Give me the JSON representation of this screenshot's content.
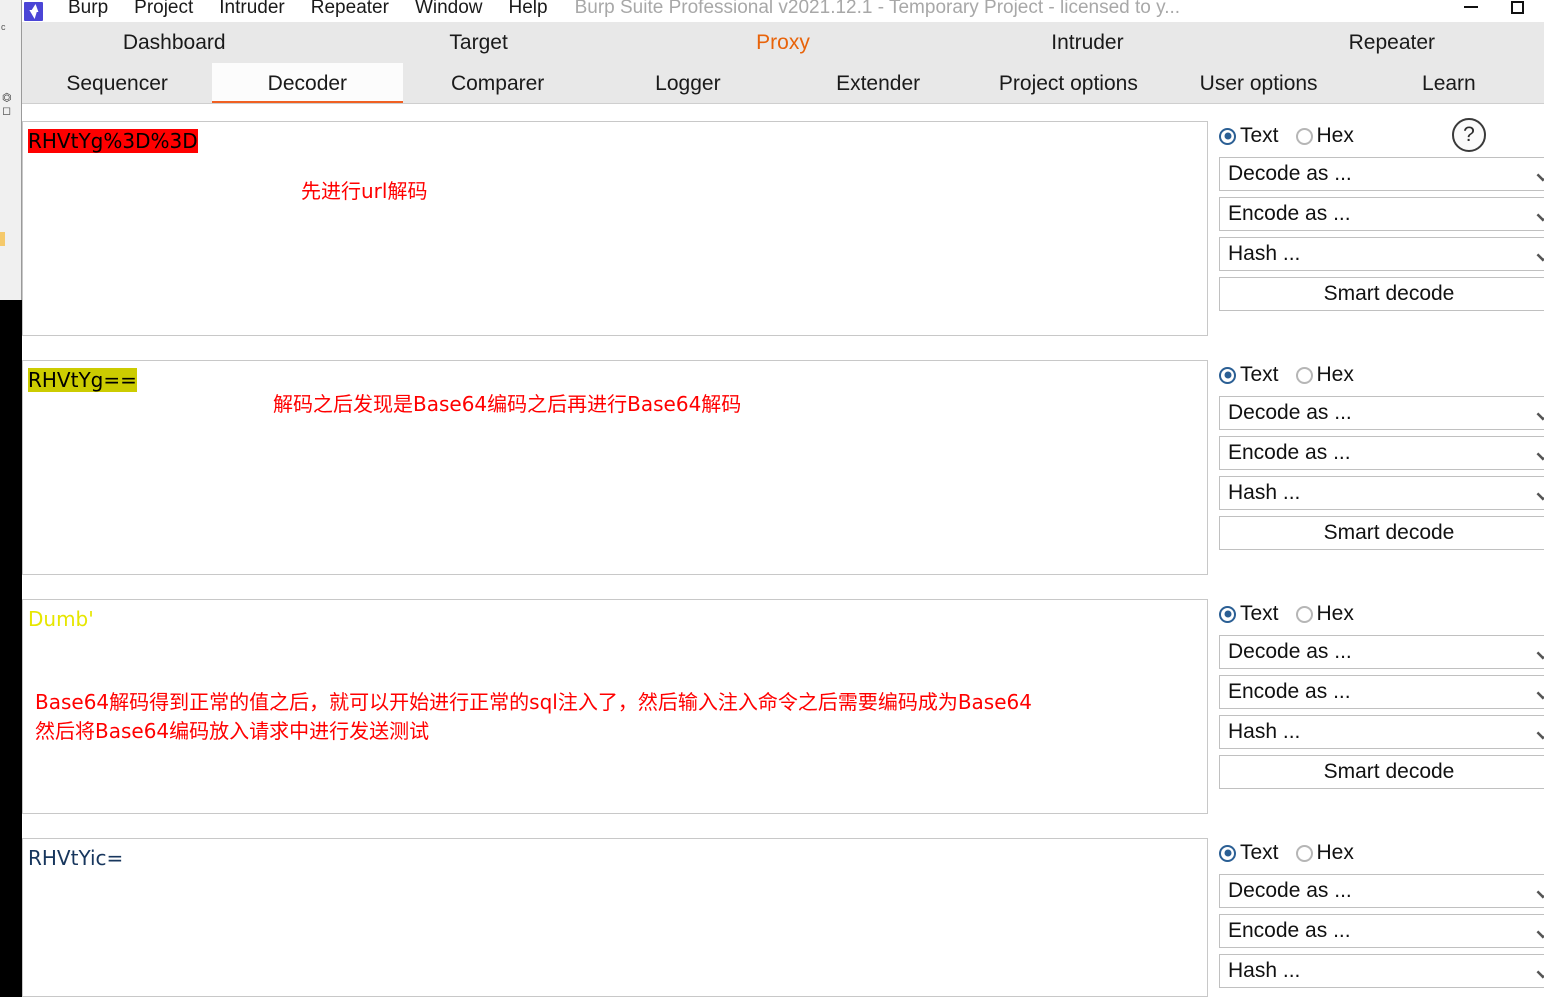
{
  "window": {
    "title": "Burp Suite Professional v2021.12.1 - Temporary Project - licensed to y...",
    "minimize_label": "—",
    "maximize_label": "❑"
  },
  "menu": {
    "logo_name": "burp-logo",
    "items": [
      {
        "label": "Burp"
      },
      {
        "label": "Project"
      },
      {
        "label": "Intruder"
      },
      {
        "label": "Repeater"
      },
      {
        "label": "Window"
      },
      {
        "label": "Help"
      }
    ]
  },
  "tabs": {
    "row1": [
      {
        "label": "Dashboard",
        "active": false,
        "accent": false
      },
      {
        "label": "Target",
        "active": false,
        "accent": false
      },
      {
        "label": "Proxy",
        "active": false,
        "accent": true
      },
      {
        "label": "Intruder",
        "active": false,
        "accent": false
      },
      {
        "label": "Repeater",
        "active": false,
        "accent": false
      }
    ],
    "row2": [
      {
        "label": "Sequencer",
        "active": false,
        "accent": false
      },
      {
        "label": "Decoder",
        "active": true,
        "accent": false
      },
      {
        "label": "Comparer",
        "active": false,
        "accent": false
      },
      {
        "label": "Logger",
        "active": false,
        "accent": false
      },
      {
        "label": "Extender",
        "active": false,
        "accent": false
      },
      {
        "label": "Project options",
        "active": false,
        "accent": false
      },
      {
        "label": "User options",
        "active": false,
        "accent": false
      },
      {
        "label": "Learn",
        "active": false,
        "accent": false
      }
    ],
    "active_tab": "Decoder",
    "accent_color": "#f06022"
  },
  "controls": {
    "text_label": "Text",
    "hex_label": "Hex",
    "help_label": "?",
    "decode_as": "Decode as ...",
    "encode_as": "Encode as ...",
    "hash": "Hash ...",
    "smart_decode": "Smart decode"
  },
  "panels": [
    {
      "id": "panel-1",
      "value": "RHVtYg%3D%3D",
      "highlight": "red",
      "highlight_color": "#ff0000",
      "note": "先进行url解码",
      "has_help": true,
      "has_smart_decode": true
    },
    {
      "id": "panel-2",
      "value": "RHVtYg==",
      "highlight": "yellow",
      "highlight_color": "#cccc00",
      "note": "解码之后发现是Base64编码之后再进行Base64解码",
      "has_help": false,
      "has_smart_decode": true
    },
    {
      "id": "panel-3",
      "value": "Dumb'",
      "highlight": "none",
      "text_color": "#e6e600",
      "note": "Base64解码得到正常的值之后，就可以开始进行正常的sql注入了，然后输入注入命令之后需要编码成为Base64\n然后将Base64编码放入请求中进行发送测试",
      "has_help": false,
      "has_smart_decode": true
    },
    {
      "id": "panel-4",
      "value": "RHVtYic=",
      "highlight": "none",
      "text_color": "#17365d",
      "note": "",
      "has_help": false,
      "has_smart_decode": false
    }
  ]
}
